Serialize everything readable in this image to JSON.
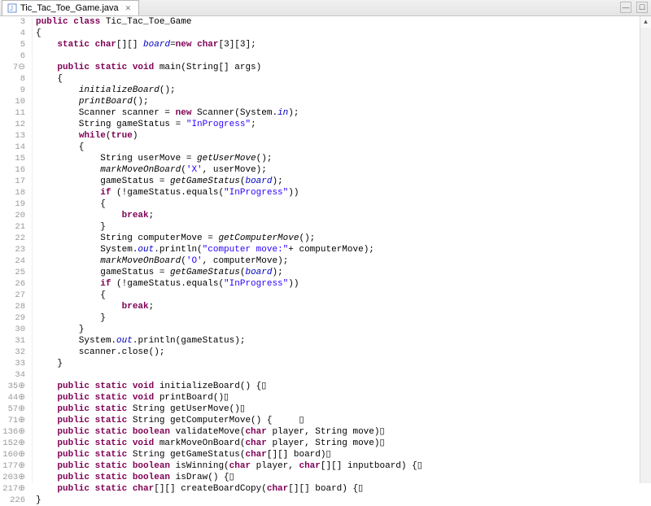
{
  "tab": {
    "filename": "Tic_Tac_Toe_Game.java"
  },
  "gutter": [
    {
      "n": "3"
    },
    {
      "n": "4"
    },
    {
      "n": "5"
    },
    {
      "n": "6"
    },
    {
      "n": "7",
      "m": "⊖"
    },
    {
      "n": "8"
    },
    {
      "n": "9"
    },
    {
      "n": "10"
    },
    {
      "n": "11"
    },
    {
      "n": "12"
    },
    {
      "n": "13"
    },
    {
      "n": "14"
    },
    {
      "n": "15"
    },
    {
      "n": "16"
    },
    {
      "n": "17"
    },
    {
      "n": "18"
    },
    {
      "n": "19"
    },
    {
      "n": "20"
    },
    {
      "n": "21"
    },
    {
      "n": "22"
    },
    {
      "n": "23"
    },
    {
      "n": "24"
    },
    {
      "n": "25"
    },
    {
      "n": "26"
    },
    {
      "n": "27"
    },
    {
      "n": "28"
    },
    {
      "n": "29"
    },
    {
      "n": "30"
    },
    {
      "n": "31"
    },
    {
      "n": "32"
    },
    {
      "n": "33"
    },
    {
      "n": "34"
    },
    {
      "n": "35",
      "m": "⊕"
    },
    {
      "n": "44",
      "m": "⊕"
    },
    {
      "n": "57",
      "m": "⊕"
    },
    {
      "n": "71",
      "m": "⊕"
    },
    {
      "n": "136",
      "m": "⊕"
    },
    {
      "n": "152",
      "m": "⊕"
    },
    {
      "n": "160",
      "m": "⊕"
    },
    {
      "n": "177",
      "m": "⊕"
    },
    {
      "n": "203",
      "m": "⊕"
    },
    {
      "n": "217",
      "m": "⊕"
    },
    {
      "n": "226"
    }
  ],
  "code": {
    "l3_pre": "public class",
    "l3_name": " Tic_Tac_Toe_Game",
    "l4": "{",
    "l5_a": "    ",
    "l5_kw1": "static",
    "l5_sp1": " ",
    "l5_kw2": "char",
    "l5_b": "[][] ",
    "l5_fld": "board",
    "l5_c": "=",
    "l5_kw3": "new",
    "l5_sp2": " ",
    "l5_kw4": "char",
    "l5_d": "[3][3];",
    "l6": "",
    "l7_a": "    ",
    "l7_kw1": "public static void",
    "l7_b": " main(String[] args)",
    "l8": "    {",
    "l9_a": "        ",
    "l9_m": "initializeBoard",
    "l9_b": "();",
    "l10_a": "        ",
    "l10_m": "printBoard",
    "l10_b": "();",
    "l11_a": "        Scanner scanner = ",
    "l11_kw": "new",
    "l11_b": " Scanner(System.",
    "l11_fld": "in",
    "l11_c": ");",
    "l12_a": "        String gameStatus = ",
    "l12_str": "\"InProgress\"",
    "l12_b": ";",
    "l13_a": "        ",
    "l13_kw": "while",
    "l13_b": "(",
    "l13_kw2": "true",
    "l13_c": ")",
    "l14": "        {",
    "l15_a": "            String userMove = ",
    "l15_m": "getUserMove",
    "l15_b": "();",
    "l16_a": "            ",
    "l16_m": "markMoveOnBoard",
    "l16_b": "(",
    "l16_str": "'X'",
    "l16_c": ", userMove);",
    "l17_a": "            gameStatus = ",
    "l17_m": "getGameStatus",
    "l17_b": "(",
    "l17_fld": "board",
    "l17_c": ");",
    "l18_a": "            ",
    "l18_kw": "if",
    "l18_b": " (!gameStatus.equals(",
    "l18_str": "\"InProgress\"",
    "l18_c": "))",
    "l19": "            {",
    "l20_a": "                ",
    "l20_kw": "break",
    "l20_b": ";",
    "l21": "            }",
    "l22_a": "            String computerMove = ",
    "l22_m": "getComputerMove",
    "l22_b": "();",
    "l23_a": "            System.",
    "l23_fld": "out",
    "l23_b": ".println(",
    "l23_str": "\"computer move:\"",
    "l23_c": "+ computerMove);",
    "l24_a": "            ",
    "l24_m": "markMoveOnBoard",
    "l24_b": "(",
    "l24_str": "'O'",
    "l24_c": ", computerMove);",
    "l25_a": "            gameStatus = ",
    "l25_m": "getGameStatus",
    "l25_b": "(",
    "l25_fld": "board",
    "l25_c": ");",
    "l26_a": "            ",
    "l26_kw": "if",
    "l26_b": " (!gameStatus.equals(",
    "l26_str": "\"InProgress\"",
    "l26_c": "))",
    "l27": "            {",
    "l28_a": "                ",
    "l28_kw": "break",
    "l28_b": ";",
    "l29": "            }",
    "l30": "        }",
    "l31_a": "        System.",
    "l31_fld": "out",
    "l31_b": ".println(gameStatus);",
    "l32": "        scanner.close();",
    "l33": "    }",
    "l34": "",
    "l35_a": "    ",
    "l35_kw": "public static void",
    "l35_b": " initializeBoard() {▯",
    "l44_a": "    ",
    "l44_kw": "public static void",
    "l44_b": " printBoard()▯",
    "l57_a": "    ",
    "l57_kw": "public static",
    "l57_b": " String getUserMove()▯",
    "l71_a": "    ",
    "l71_kw": "public static",
    "l71_b": " String getComputerMove() {     ▯",
    "l136_a": "    ",
    "l136_kw": "public static boolean",
    "l136_b": " validateMove(",
    "l136_kw2": "char",
    "l136_c": " player, String move)▯",
    "l152_a": "    ",
    "l152_kw": "public static void",
    "l152_b": " markMoveOnBoard(",
    "l152_kw2": "char",
    "l152_c": " player, String move)▯",
    "l160_a": "    ",
    "l160_kw": "public static",
    "l160_b": " String getGameStatus(",
    "l160_kw2": "char",
    "l160_c": "[][] board)▯",
    "l177_a": "    ",
    "l177_kw": "public static boolean",
    "l177_b": " isWinning(",
    "l177_kw2": "char",
    "l177_c": " player, ",
    "l177_kw3": "char",
    "l177_d": "[][] inputboard) {▯",
    "l203_a": "    ",
    "l203_kw": "public static boolean",
    "l203_b": " isDraw() {▯",
    "l217_a": "    ",
    "l217_kw": "public static char",
    "l217_b": "[][] createBoardCopy(",
    "l217_kw2": "char",
    "l217_c": "[][] board) {▯",
    "l226": "}"
  }
}
